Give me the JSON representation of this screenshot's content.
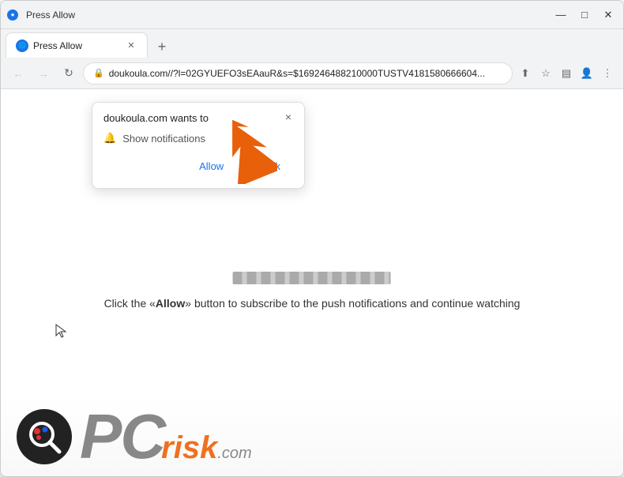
{
  "window": {
    "title": "Press Allow",
    "favicon_label": "●"
  },
  "titlebar": {
    "minimize_label": "—",
    "maximize_label": "□",
    "close_label": "✕",
    "chevron_down": "⌄"
  },
  "tabs": [
    {
      "title": "Press Allow",
      "active": true
    }
  ],
  "newtab_label": "+",
  "addressbar": {
    "back_icon": "←",
    "forward_icon": "→",
    "refresh_icon": "↻",
    "lock_icon": "🔒",
    "url": "doukoula.com//?l=02GYUEFO3sEAauR&s=$169246488210000TUSTV4181580666604...",
    "share_icon": "⬆",
    "star_icon": "☆",
    "sidebar_icon": "▤",
    "profile_icon": "👤",
    "menu_icon": "⋮"
  },
  "popup": {
    "site_text": "doukoula.com wants to",
    "permission_text": "Show notifications",
    "allow_label": "Allow",
    "block_label": "Block",
    "close_label": "×"
  },
  "page": {
    "message": "Click the «Allow» button to subscribe to the push notifications and continue watching"
  },
  "logo": {
    "pc_text": "PC",
    "risk_text": "risk",
    "com_text": ".com"
  }
}
